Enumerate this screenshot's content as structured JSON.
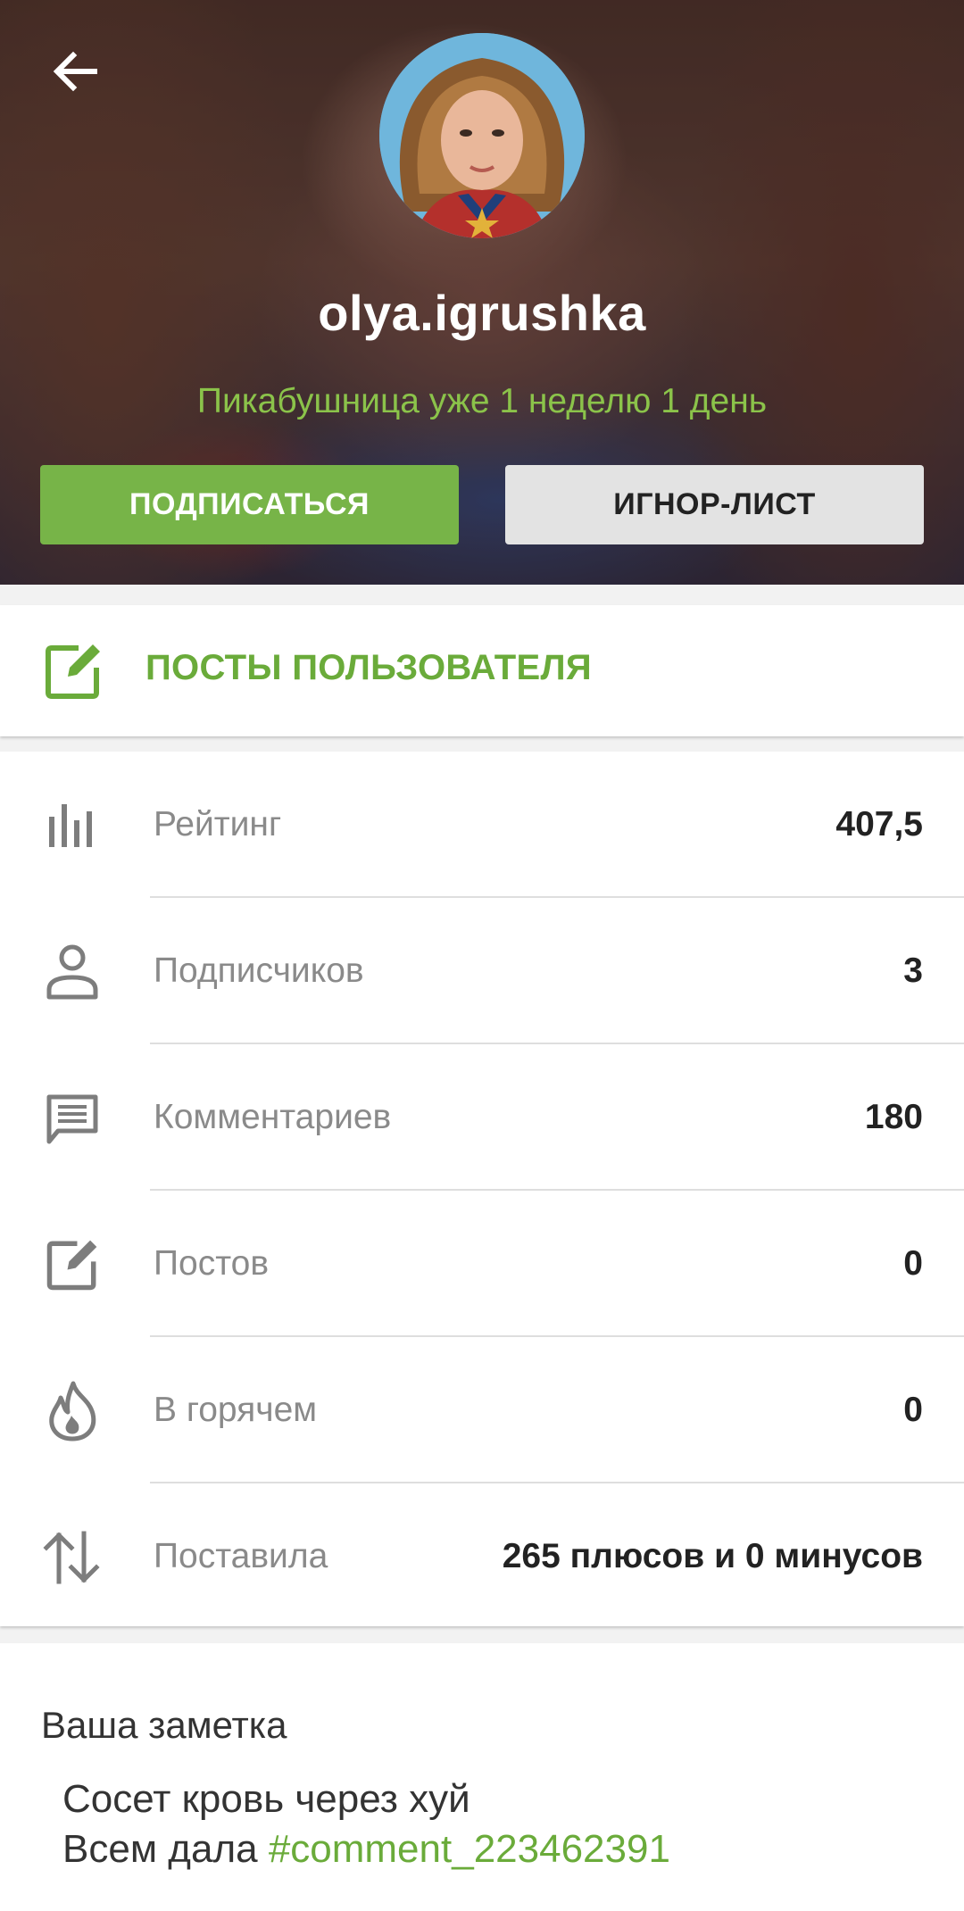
{
  "header": {
    "back_icon": "arrow-left-icon",
    "username": "olya.igrushka",
    "tenure": "Пикабушница уже 1 неделю 1 день",
    "subscribe_label": "ПОДПИСАТЬСЯ",
    "ignore_label": "ИГНОР-ЛИСТ"
  },
  "posts_link": {
    "icon": "edit-square-icon",
    "label": "ПОСТЫ ПОЛЬЗОВАТЕЛЯ"
  },
  "stats": [
    {
      "icon": "bar-chart-icon",
      "label": "Рейтинг",
      "value": "407,5"
    },
    {
      "icon": "person-icon",
      "label": "Подписчиков",
      "value": "3"
    },
    {
      "icon": "comment-icon",
      "label": "Комментариев",
      "value": "180"
    },
    {
      "icon": "edit-square-icon",
      "label": "Постов",
      "value": "0"
    },
    {
      "icon": "flame-icon",
      "label": "В горячем",
      "value": "0"
    },
    {
      "icon": "sort-arrows-icon",
      "label": "Поставила",
      "value": "265 плюсов и 0 минусов"
    }
  ],
  "note": {
    "title": "Ваша заметка",
    "line1": "Сосет кровь через хуй",
    "line2_prefix": "Всем дала ",
    "line2_tag": "#comment_223462391"
  },
  "colors": {
    "accent_green": "#77b448",
    "text_green": "#6aab3a",
    "label_gray": "#8a8a8a",
    "value_dark": "#222222"
  }
}
